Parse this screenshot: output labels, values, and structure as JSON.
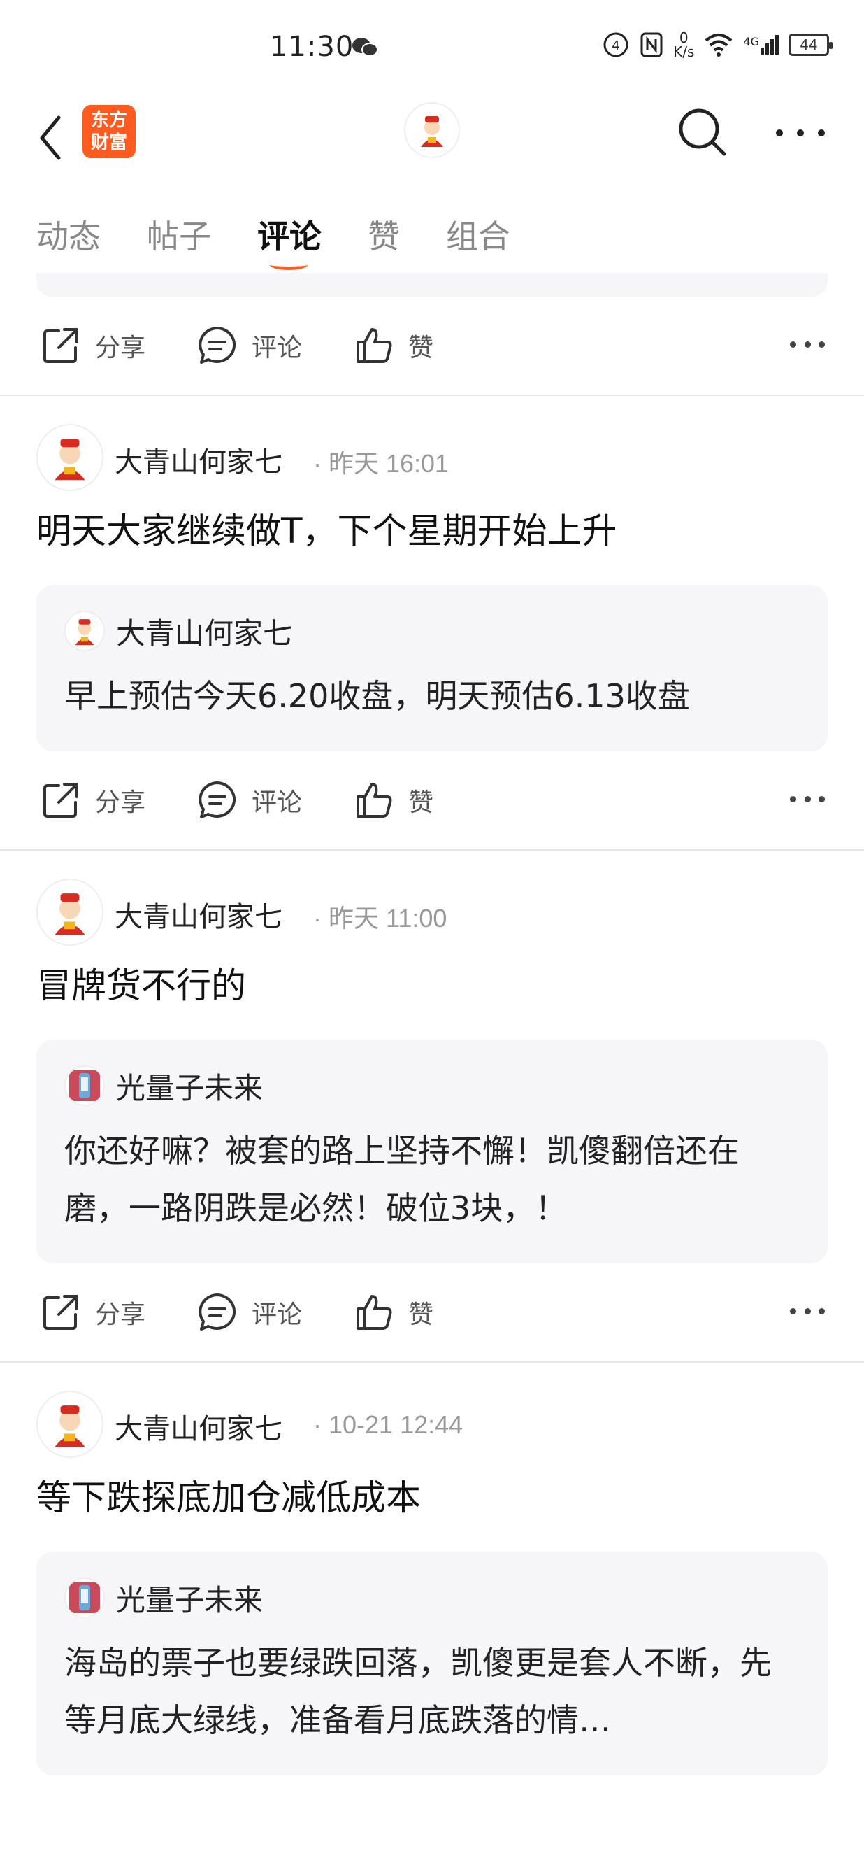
{
  "status_bar": {
    "time": "11:30",
    "speed_value": "0",
    "speed_unit": "K/s",
    "network": "4G",
    "battery": "44"
  },
  "header": {
    "brand_line1": "东方",
    "brand_line2": "财富"
  },
  "tabs": [
    {
      "label": "动态",
      "active": false
    },
    {
      "label": "帖子",
      "active": false
    },
    {
      "label": "评论",
      "active": true
    },
    {
      "label": "赞",
      "active": false
    },
    {
      "label": "组合",
      "active": false
    }
  ],
  "actions": {
    "share": "分享",
    "comment": "评论",
    "like": "赞"
  },
  "posts": [
    {
      "author": "大青山何家七",
      "time": "· 昨天 16:01",
      "text": "明天大家继续做T，下个星期开始上升",
      "quote_author": "大青山何家七",
      "quote_text": "早上预估今天6.20收盘，明天预估6.13收盘"
    },
    {
      "author": "大青山何家七",
      "time": "· 昨天 11:00",
      "text": "冒牌货不行的",
      "quote_author": "光量子未来",
      "quote_text": "你还好嘛？被套的路上坚持不懈！凯傻翻倍还在磨，一路阴跌是必然！破位3块，！"
    },
    {
      "author": "大青山何家七",
      "time": "· 10-21 12:44",
      "text": "等下跌探底加仓减低成本",
      "quote_author": "光量子未来",
      "quote_text": "海岛的票子也要绿跌回落，凯傻更是套人不断，先等月底大绿线，准备看月底跌落的情…"
    }
  ],
  "colors": {
    "brand": "#ff5a1f",
    "quote_bg": "#f6f6f8"
  }
}
